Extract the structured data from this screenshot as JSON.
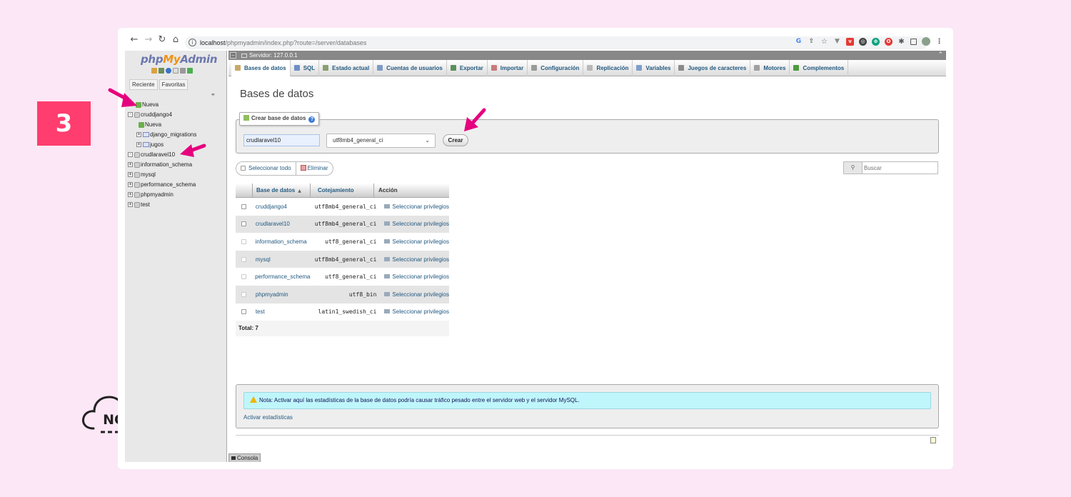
{
  "step_number": "3",
  "brand_logo_text": "NC",
  "browser": {
    "url_host": "localhost",
    "url_path": "/phpmyadmin/index.php?route=/server/databases"
  },
  "nav": {
    "logo_php": "php",
    "logo_my": "My",
    "logo_admin": "Admin",
    "tabs": [
      "Reciente",
      "Favoritas"
    ],
    "tree": {
      "nueva": "Nueva",
      "db1": "cruddjango4",
      "db1_nueva": "Nueva",
      "db1_t1": "django_migrations",
      "db1_t2": "jugos",
      "db2": "crudlaravel10",
      "db3": "information_schema",
      "db4": "mysql",
      "db5": "performance_schema",
      "db6": "phpmyadmin",
      "db7": "test"
    }
  },
  "main": {
    "server_label": "Servidor: 127.0.0.1",
    "tabs": [
      {
        "label": "Bases de datos",
        "icon_color": "#c9a86a"
      },
      {
        "label": "SQL",
        "icon_color": "#6d8fc7"
      },
      {
        "label": "Estado actual",
        "icon_color": "#8aa06f"
      },
      {
        "label": "Cuentas de usuarios",
        "icon_color": "#7d9bc4"
      },
      {
        "label": "Exportar",
        "icon_color": "#5a8f5a"
      },
      {
        "label": "Importar",
        "icon_color": "#c77b7b"
      },
      {
        "label": "Configuración",
        "icon_color": "#9a9a9a"
      },
      {
        "label": "Replicación",
        "icon_color": "#b8b8b8"
      },
      {
        "label": "Variables",
        "icon_color": "#7e9fc9"
      },
      {
        "label": "Juegos de caracteres",
        "icon_color": "#8a8a8a"
      },
      {
        "label": "Motores",
        "icon_color": "#a0a0a0"
      },
      {
        "label": "Complementos",
        "icon_color": "#4f9a3f"
      }
    ],
    "page_title": "Bases de datos",
    "create": {
      "legend": "Crear base de datos",
      "db_name_value": "crudlaravel10",
      "collation": "utf8mb4_general_ci",
      "button": "Crear"
    },
    "select_all": "Seleccionar todo",
    "delete": "Eliminar",
    "search_placeholder": "Buscar",
    "table": {
      "headers": [
        "Base de datos",
        "Cotejamiento",
        "Acción"
      ],
      "action_label": "Seleccionar privilegios",
      "rows": [
        {
          "name": "cruddjango4",
          "collation": "utf8mb4_general_ci"
        },
        {
          "name": "crudlaravel10",
          "collation": "utf8mb4_general_ci"
        },
        {
          "name": "information_schema",
          "collation": "utf8_general_ci"
        },
        {
          "name": "mysql",
          "collation": "utf8mb4_general_ci"
        },
        {
          "name": "performance_schema",
          "collation": "utf8_general_ci"
        },
        {
          "name": "phpmyadmin",
          "collation": "utf8_bin"
        },
        {
          "name": "test",
          "collation": "latin1_swedish_ci"
        }
      ],
      "total": "Total: 7"
    },
    "notice": "Nota: Activar aquí las estadísticas de la base de datos podría causar tráfico pesado entre el servidor web y el servidor MySQL.",
    "activate_stats": "Activar estadísticas",
    "console": "Consola"
  },
  "colors": {
    "badge": "#ff3d6e",
    "arrow": "#e6007e",
    "link": "#235a81"
  }
}
